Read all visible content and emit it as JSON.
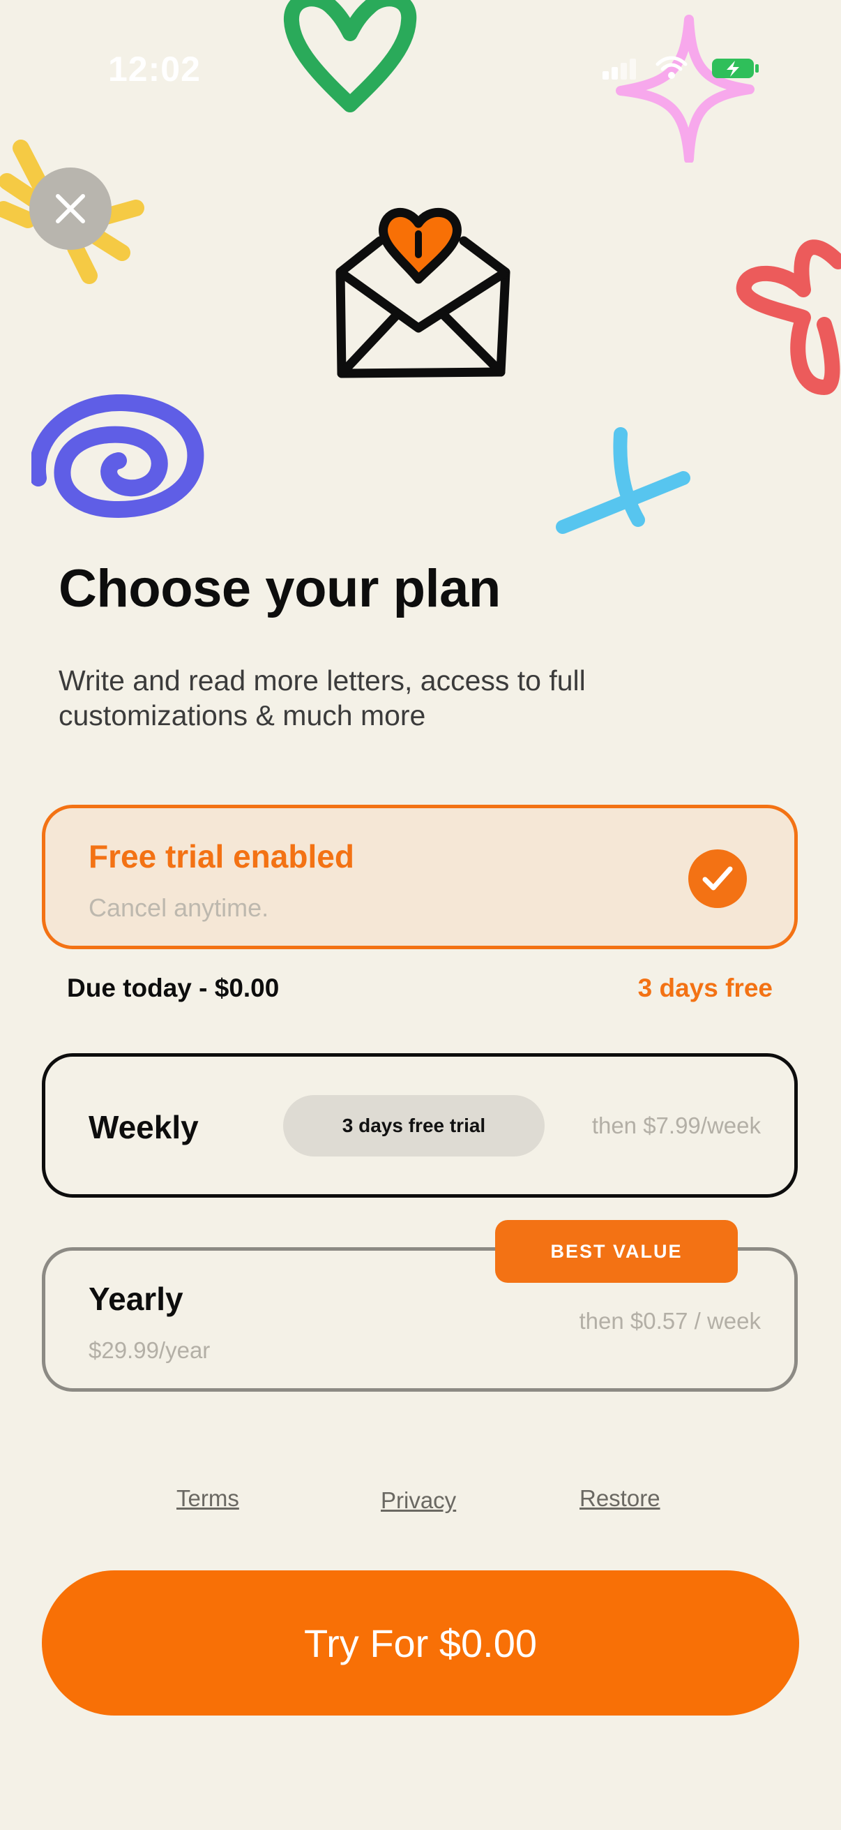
{
  "status_bar": {
    "time": "12:02"
  },
  "header": {
    "title": "Choose your plan",
    "subtitle": "Write and read more letters, access to full customizations & much more"
  },
  "trial": {
    "title": "Free trial enabled",
    "subtitle": "Cancel anytime.",
    "enabled": true
  },
  "due": {
    "left": "Due today - $0.00",
    "right": "3 days free"
  },
  "plans": [
    {
      "name": "Weekly",
      "badge": "3 days free trial",
      "then": "then $7.99/week"
    },
    {
      "name": "Yearly",
      "price": "$29.99/year",
      "then": "then $0.57 / week",
      "tag": "BEST VALUE"
    }
  ],
  "footer": {
    "terms": "Terms",
    "privacy": "Privacy",
    "restore": "Restore"
  },
  "cta": {
    "label": "Try For $0.00"
  },
  "icons": {
    "close": "close-icon",
    "check": "checkmark-icon",
    "hero": "envelope-heart-icon"
  },
  "colors": {
    "background": "#f4f1e7",
    "accent": "#f37214",
    "cta": "#f87006"
  }
}
